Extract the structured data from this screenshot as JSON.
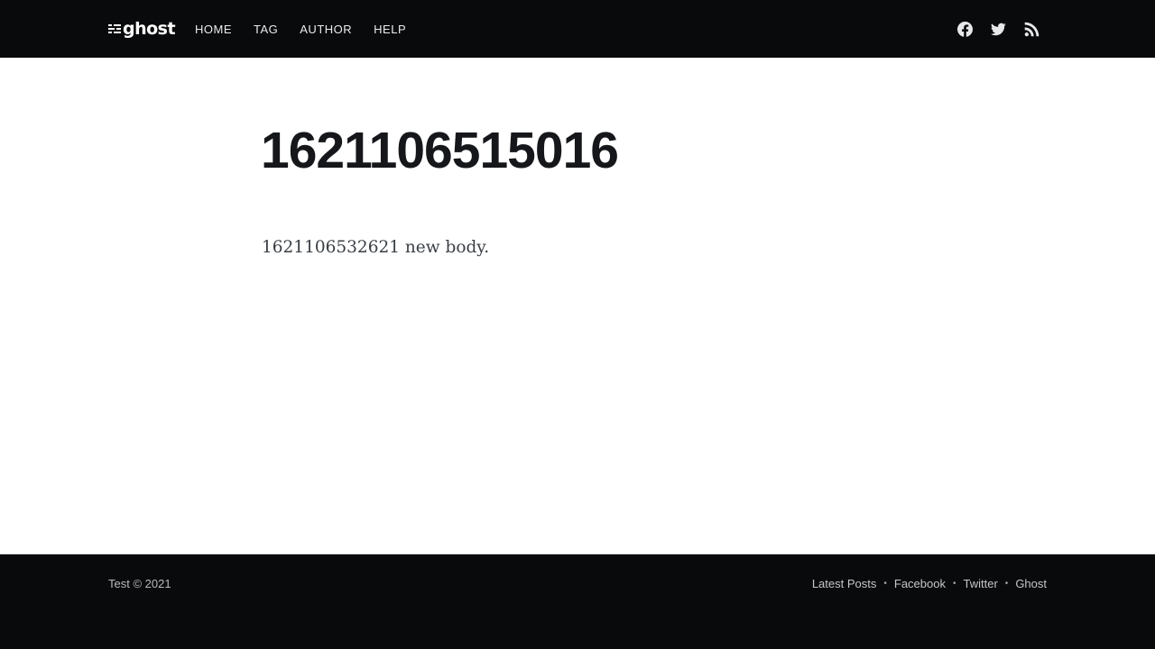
{
  "header": {
    "logo_text": "ghost",
    "nav": [
      {
        "label": "HOME"
      },
      {
        "label": "TAG"
      },
      {
        "label": "AUTHOR"
      },
      {
        "label": "HELP"
      }
    ],
    "social_icons": [
      "facebook-icon",
      "twitter-icon",
      "rss-icon"
    ]
  },
  "post": {
    "title": "1621106515016",
    "body": "1621106532621 new body."
  },
  "footer": {
    "copyright": "Test © 2021",
    "links": [
      {
        "label": "Latest Posts"
      },
      {
        "label": "Facebook"
      },
      {
        "label": "Twitter"
      },
      {
        "label": "Ghost"
      }
    ],
    "separator": "•"
  },
  "colors": {
    "header_bg": "#090a0b",
    "footer_bg": "#090a0b",
    "title": "#15171a",
    "body_text": "#3a3f45"
  }
}
